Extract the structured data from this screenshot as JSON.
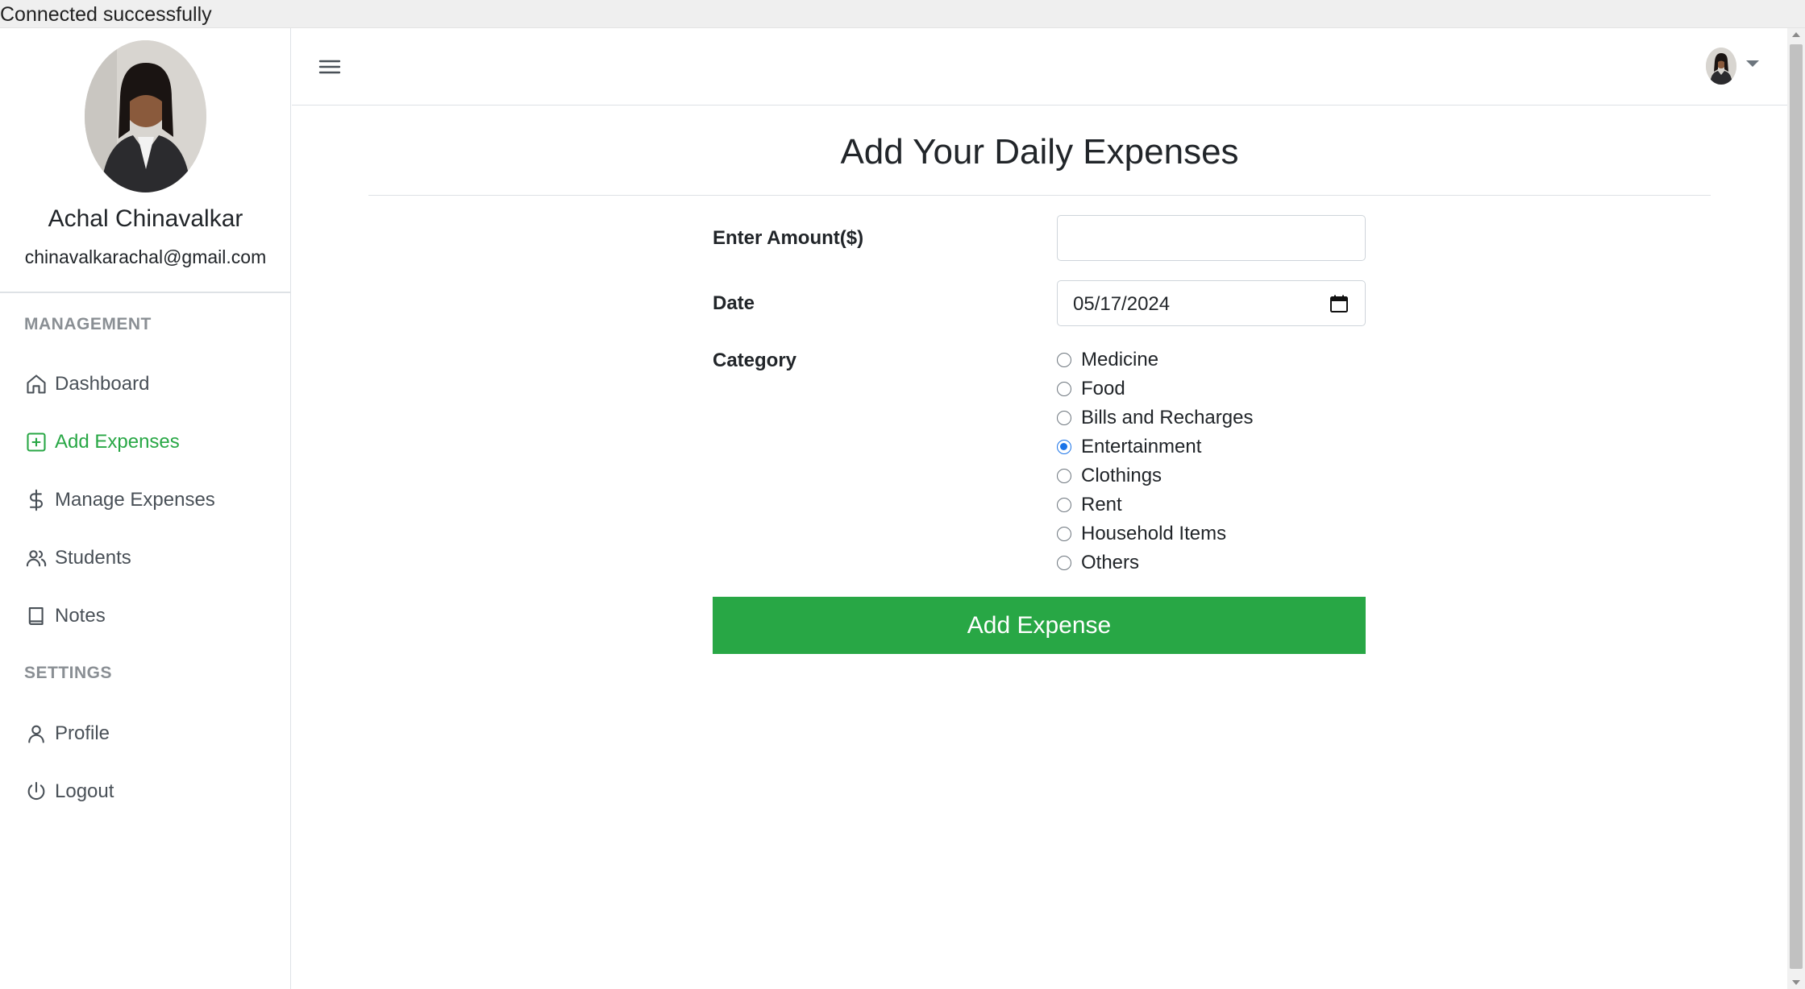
{
  "status_bar": {
    "text": "Connected successfully"
  },
  "sidebar": {
    "user": {
      "name": "Achal Chinavalkar",
      "email": "chinavalkarachal@gmail.com"
    },
    "sections": [
      {
        "heading": "MANAGEMENT"
      },
      {
        "heading": "SETTINGS"
      }
    ],
    "items": [
      {
        "label": "Dashboard",
        "icon": "home-icon",
        "active": false
      },
      {
        "label": "Add Expenses",
        "icon": "plus-square-icon",
        "active": true
      },
      {
        "label": "Manage Expenses",
        "icon": "dollar-icon",
        "active": false
      },
      {
        "label": "Students",
        "icon": "users-icon",
        "active": false
      },
      {
        "label": "Notes",
        "icon": "book-icon",
        "active": false
      },
      {
        "label": "Profile",
        "icon": "user-icon",
        "active": false
      },
      {
        "label": "Logout",
        "icon": "power-icon",
        "active": false
      }
    ]
  },
  "topbar": {
    "menu_icon": "hamburger-icon",
    "avatar_icon": "user-avatar",
    "dropdown_icon": "caret-down-icon"
  },
  "main": {
    "title": "Add Your Daily Expenses",
    "form": {
      "amount": {
        "label": "Enter Amount($)",
        "value": "",
        "placeholder": ""
      },
      "date": {
        "label": "Date",
        "value": "05/17/2024"
      },
      "category": {
        "label": "Category",
        "options": [
          "Medicine",
          "Food",
          "Bills and Recharges",
          "Entertainment",
          "Clothings",
          "Rent",
          "Household Items",
          "Others"
        ],
        "selected": "Entertainment"
      },
      "submit_label": "Add Expense"
    }
  },
  "colors": {
    "accent": "#28a745",
    "radio_checked": "#1a73e8",
    "muted": "#8a8f94"
  }
}
